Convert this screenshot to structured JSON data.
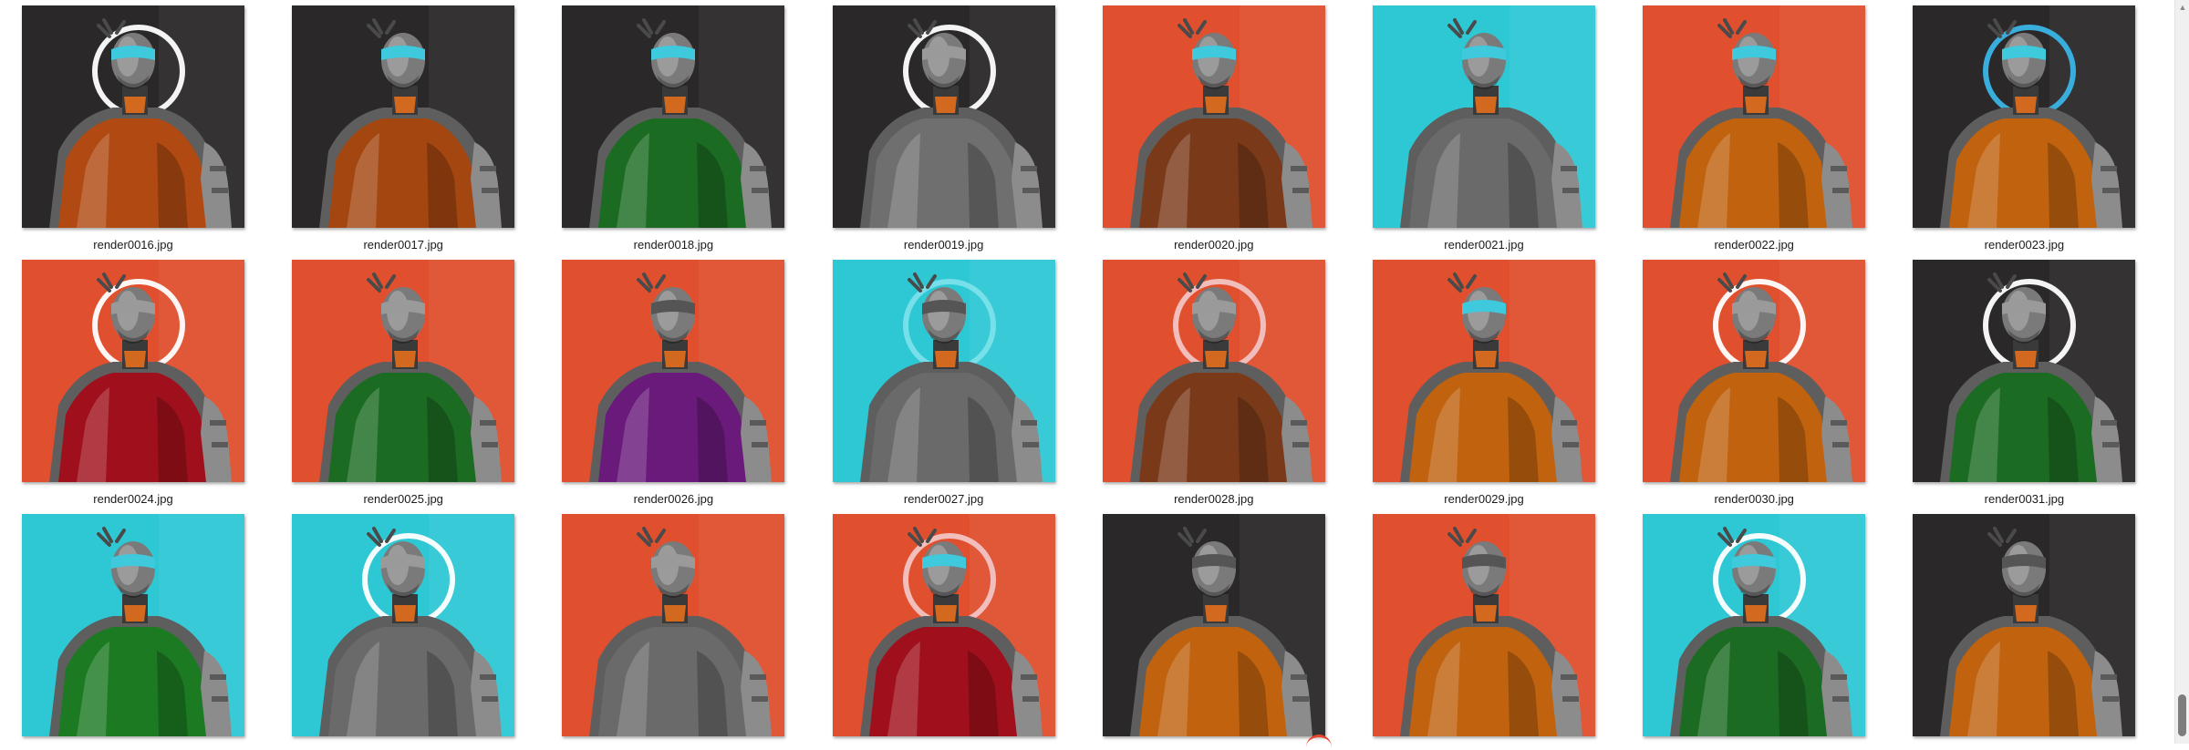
{
  "gallery": {
    "items": [
      {
        "file": "render0016.jpg",
        "bg": "#2a2828",
        "vest": "#b04a12",
        "ring": true,
        "visor": "#3ec9dc",
        "glow": "#ffffff"
      },
      {
        "file": "render0017.jpg",
        "bg": "#2a2828",
        "vest": "#a34610",
        "ring": false,
        "visor": "#3ec9dc",
        "glow": "#ffffff"
      },
      {
        "file": "render0018.jpg",
        "bg": "#2a2828",
        "vest": "#1c6b22",
        "ring": false,
        "visor": "#3ec9dc",
        "glow": "#ffffff"
      },
      {
        "file": "render0019.jpg",
        "bg": "#2a2828",
        "vest": "#6f6f6f",
        "ring": true,
        "visor": "#9a9a9a",
        "glow": "#ffffff"
      },
      {
        "file": "render0020.jpg",
        "bg": "#e0502e",
        "vest": "#7a3a1a",
        "ring": false,
        "visor": "#3ec9dc",
        "glow": "#ffffff"
      },
      {
        "file": "render0021.jpg",
        "bg": "#2ec8d4",
        "vest": "#6a6a6a",
        "ring": false,
        "visor": "#3ec9dc",
        "glow": "#ffffff"
      },
      {
        "file": "render0022.jpg",
        "bg": "#e0502e",
        "vest": "#c0620e",
        "ring": false,
        "visor": "#3ec9dc",
        "glow": "#ffffff"
      },
      {
        "file": "render0023.jpg",
        "bg": "#2a2828",
        "vest": "#c0620e",
        "ring": true,
        "visor": "#3ec9dc",
        "glow": "#3ab5e6"
      },
      {
        "file": "render0024.jpg",
        "bg": "#e0502e",
        "vest": "#a0101c",
        "ring": true,
        "visor": "#9a9a9a",
        "glow": "#ffffff"
      },
      {
        "file": "render0025.jpg",
        "bg": "#e0502e",
        "vest": "#1c6b22",
        "ring": false,
        "visor": "#9a9a9a",
        "glow": "#ffffff"
      },
      {
        "file": "render0026.jpg",
        "bg": "#e0502e",
        "vest": "#6a1a7a",
        "ring": false,
        "visor": "#555555",
        "glow": "#ffffff"
      },
      {
        "file": "render0027.jpg",
        "bg": "#2ec8d4",
        "vest": "#6a6a6a",
        "ring": true,
        "visor": "#555555",
        "glow": "#7ae0ea"
      },
      {
        "file": "render0028.jpg",
        "bg": "#e0502e",
        "vest": "#7a3a1a",
        "ring": true,
        "visor": "#9a9a9a",
        "glow": "#f2c4c4"
      },
      {
        "file": "render0029.jpg",
        "bg": "#e0502e",
        "vest": "#c0620e",
        "ring": false,
        "visor": "#3ec9dc",
        "glow": "#ffffff"
      },
      {
        "file": "render0030.jpg",
        "bg": "#e0502e",
        "vest": "#c0620e",
        "ring": true,
        "visor": "#9a9a9a",
        "glow": "#ffffff"
      },
      {
        "file": "render0031.jpg",
        "bg": "#2a2828",
        "vest": "#1c6b22",
        "ring": true,
        "visor": "#9a9a9a",
        "glow": "#ffffff"
      },
      {
        "file": "",
        "bg": "#2ec8d4",
        "vest": "#1c7a22",
        "ring": false,
        "visor": "#3ec9dc",
        "glow": "#ffffff"
      },
      {
        "file": "",
        "bg": "#2ec8d4",
        "vest": "#6a6a6a",
        "ring": true,
        "visor": "#9a9a9a",
        "glow": "#ffffff"
      },
      {
        "file": "",
        "bg": "#e0502e",
        "vest": "#6a6a6a",
        "ring": false,
        "visor": "#9a9a9a",
        "glow": "#ffffff"
      },
      {
        "file": "",
        "bg": "#e0502e",
        "vest": "#a0101c",
        "ring": true,
        "visor": "#3ec9dc",
        "glow": "#f2c4c4"
      },
      {
        "file": "",
        "bg": "#2a2828",
        "vest": "#c0620e",
        "ring": false,
        "visor": "#555555",
        "glow": "#ffffff"
      },
      {
        "file": "",
        "bg": "#e0502e",
        "vest": "#c0620e",
        "ring": false,
        "visor": "#555555",
        "glow": "#ffffff"
      },
      {
        "file": "",
        "bg": "#2ec8d4",
        "vest": "#1c6b22",
        "ring": true,
        "visor": "#3ec9dc",
        "glow": "#ffffff"
      },
      {
        "file": "",
        "bg": "#2a2828",
        "vest": "#c0620e",
        "ring": false,
        "visor": "#555555",
        "glow": "#ffffff"
      }
    ]
  },
  "scrollbar": {
    "up_arrow_icon": "chevron-up-icon"
  }
}
